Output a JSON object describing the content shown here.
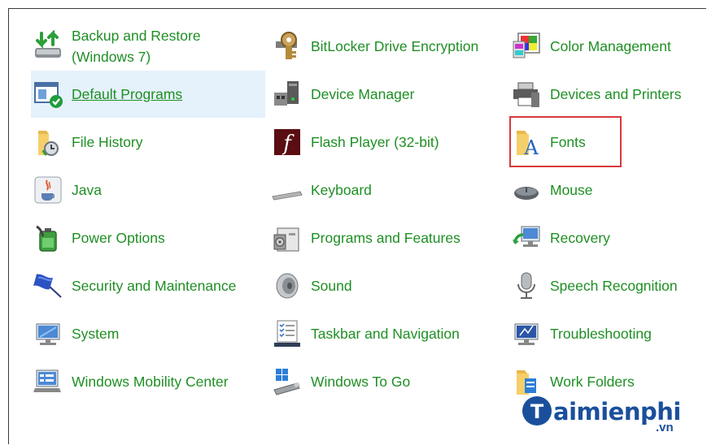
{
  "control_panel": {
    "items": [
      {
        "label_line1": "Backup and Restore",
        "label_line2": "(Windows 7)",
        "icon": "backup-restore-icon"
      },
      {
        "label": "BitLocker Drive Encryption",
        "icon": "bitlocker-icon"
      },
      {
        "label": "Color Management",
        "icon": "color-management-icon"
      },
      {
        "label": "Default Programs",
        "icon": "default-programs-icon",
        "selected": true
      },
      {
        "label": "Device Manager",
        "icon": "device-manager-icon"
      },
      {
        "label": "Devices and Printers",
        "icon": "devices-printers-icon"
      },
      {
        "label": "File History",
        "icon": "file-history-icon"
      },
      {
        "label": "Flash Player (32-bit)",
        "icon": "flash-player-icon"
      },
      {
        "label": "Fonts",
        "icon": "fonts-icon",
        "highlighted": true
      },
      {
        "label": "Java",
        "icon": "java-icon"
      },
      {
        "label": "Keyboard",
        "icon": "keyboard-icon"
      },
      {
        "label": "Mouse",
        "icon": "mouse-icon"
      },
      {
        "label": "Power Options",
        "icon": "power-options-icon"
      },
      {
        "label": "Programs and Features",
        "icon": "programs-features-icon"
      },
      {
        "label": "Recovery",
        "icon": "recovery-icon"
      },
      {
        "label": "Security and Maintenance",
        "icon": "security-flag-icon"
      },
      {
        "label": "Sound",
        "icon": "speaker-icon"
      },
      {
        "label": "Speech Recognition",
        "icon": "microphone-icon"
      },
      {
        "label": "System",
        "icon": "system-monitor-icon"
      },
      {
        "label": "Taskbar and Navigation",
        "icon": "taskbar-icon"
      },
      {
        "label": "Troubleshooting",
        "icon": "troubleshooting-icon"
      },
      {
        "label": "Windows Mobility Center",
        "icon": "mobility-center-icon"
      },
      {
        "label": "Windows To Go",
        "icon": "usb-drive-icon"
      },
      {
        "label": "Work Folders",
        "icon": "work-folders-icon"
      }
    ]
  },
  "watermark": {
    "brand": "aimienphi",
    "tld": ".vn"
  },
  "colors": {
    "link": "#1e8f24",
    "selected_bg": "#e5f1fb",
    "highlight": "#d8393c",
    "brand": "#1a4f9c"
  }
}
